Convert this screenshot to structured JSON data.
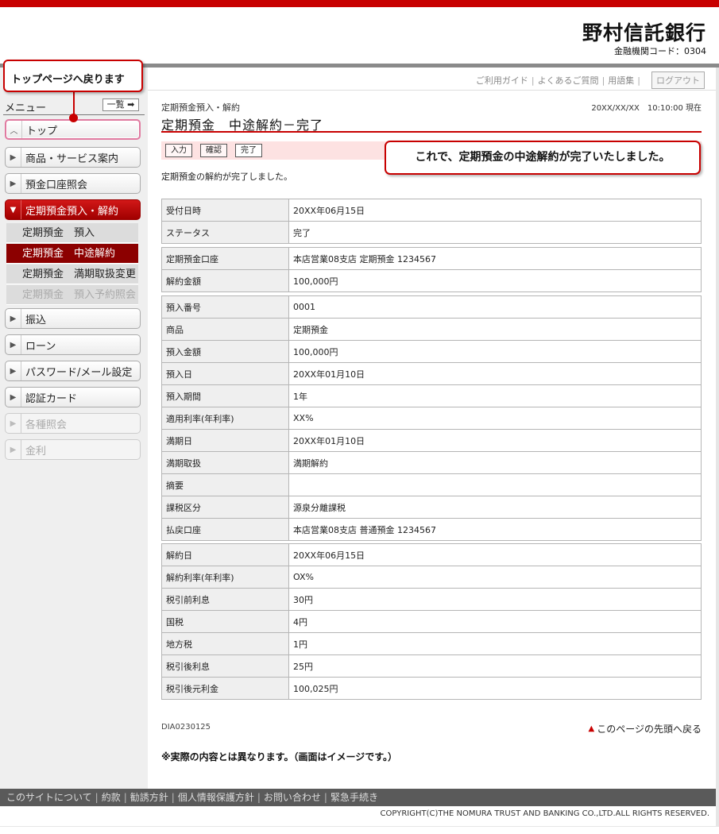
{
  "header": {
    "bank_name": "野村信託銀行",
    "bank_code": "金融機関コード：0304",
    "util_links": [
      "ご利用ガイド",
      "よくあるご質問",
      "用語集"
    ],
    "logout": "ログアウト"
  },
  "callouts": {
    "top": "トップページへ戻ります",
    "main": "これで、定期預金の中途解約が完了いたしました。"
  },
  "sidebar": {
    "title": "メニュー",
    "list_button": "一覧",
    "items": [
      {
        "label": "トップ"
      },
      {
        "label": "商品・サービス案内"
      },
      {
        "label": "預金口座照会"
      },
      {
        "label": "定期預金預入・解約"
      },
      {
        "label": "振込"
      },
      {
        "label": "ローン"
      },
      {
        "label": "パスワード/メール設定"
      },
      {
        "label": "認証カード"
      },
      {
        "label": "各種照会"
      },
      {
        "label": "金利"
      }
    ],
    "sub_items": [
      {
        "label": "定期預金　預入"
      },
      {
        "label": "定期預金　中途解約"
      },
      {
        "label": "定期預金　満期取扱変更"
      },
      {
        "label": "定期預金　預入予約照会"
      }
    ]
  },
  "main": {
    "breadcrumb": "定期預金預入・解約",
    "timestamp": "20XX/XX/XX　10:10:00 現在",
    "title": "定期預金　中途解約－完了",
    "steps": [
      "入力",
      "確認",
      "完了"
    ],
    "message": "定期預金の解約が完了しました。",
    "table1": [
      {
        "label": "受付日時",
        "value": "20XX年06月15日"
      },
      {
        "label": "ステータス",
        "value": "完了"
      }
    ],
    "table2": [
      {
        "label": "定期預金口座",
        "value": "本店営業08支店 定期預金 1234567"
      },
      {
        "label": "解約金額",
        "value": "100,000円"
      }
    ],
    "table3": [
      {
        "label": "預入番号",
        "value": "0001"
      },
      {
        "label": "商品",
        "value": "定期預金"
      },
      {
        "label": "預入金額",
        "value": "100,000円"
      },
      {
        "label": "預入日",
        "value": "20XX年01月10日"
      },
      {
        "label": "預入期間",
        "value": "1年"
      },
      {
        "label": "適用利率(年利率)",
        "value": "XX%"
      },
      {
        "label": "満期日",
        "value": "20XX年01月10日"
      },
      {
        "label": "満期取扱",
        "value": "満期解約"
      },
      {
        "label": "摘要",
        "value": ""
      },
      {
        "label": "課税区分",
        "value": "源泉分離課税"
      },
      {
        "label": "払戻口座",
        "value": "本店営業08支店 普通預金 1234567"
      }
    ],
    "table4": [
      {
        "label": "解約日",
        "value": "20XX年06月15日"
      },
      {
        "label": "解約利率(年利率)",
        "value": "OX%"
      },
      {
        "label": "税引前利息",
        "value": "30円"
      },
      {
        "label": "国税",
        "value": "4円"
      },
      {
        "label": "地方税",
        "value": "1円"
      },
      {
        "label": "税引後利息",
        "value": "25円"
      },
      {
        "label": "税引後元利金",
        "value": "100,025円"
      }
    ],
    "page_id": "DIA0230125",
    "back_to_top": "このページの先頭へ戻る",
    "note": "※実際の内容とは異なります。（画面はイメージです。）"
  },
  "footer": {
    "links": [
      "このサイトについて",
      "約款",
      "勧誘方針",
      "個人情報保護方針",
      "お問い合わせ",
      "緊急手続き"
    ],
    "copyright": "COPYRIGHT(C)THE NOMURA TRUST AND BANKING CO.,LTD.ALL RIGHTS RESERVED."
  }
}
